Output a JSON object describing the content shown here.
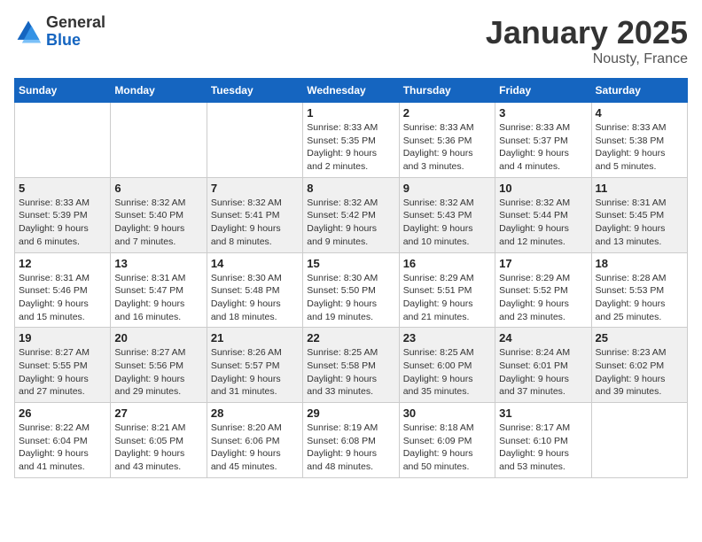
{
  "header": {
    "logo_general": "General",
    "logo_blue": "Blue",
    "month": "January 2025",
    "location": "Nousty, France"
  },
  "days_of_week": [
    "Sunday",
    "Monday",
    "Tuesday",
    "Wednesday",
    "Thursday",
    "Friday",
    "Saturday"
  ],
  "weeks": [
    [
      {
        "day": "",
        "info": ""
      },
      {
        "day": "",
        "info": ""
      },
      {
        "day": "",
        "info": ""
      },
      {
        "day": "1",
        "info": "Sunrise: 8:33 AM\nSunset: 5:35 PM\nDaylight: 9 hours\nand 2 minutes."
      },
      {
        "day": "2",
        "info": "Sunrise: 8:33 AM\nSunset: 5:36 PM\nDaylight: 9 hours\nand 3 minutes."
      },
      {
        "day": "3",
        "info": "Sunrise: 8:33 AM\nSunset: 5:37 PM\nDaylight: 9 hours\nand 4 minutes."
      },
      {
        "day": "4",
        "info": "Sunrise: 8:33 AM\nSunset: 5:38 PM\nDaylight: 9 hours\nand 5 minutes."
      }
    ],
    [
      {
        "day": "5",
        "info": "Sunrise: 8:33 AM\nSunset: 5:39 PM\nDaylight: 9 hours\nand 6 minutes."
      },
      {
        "day": "6",
        "info": "Sunrise: 8:32 AM\nSunset: 5:40 PM\nDaylight: 9 hours\nand 7 minutes."
      },
      {
        "day": "7",
        "info": "Sunrise: 8:32 AM\nSunset: 5:41 PM\nDaylight: 9 hours\nand 8 minutes."
      },
      {
        "day": "8",
        "info": "Sunrise: 8:32 AM\nSunset: 5:42 PM\nDaylight: 9 hours\nand 9 minutes."
      },
      {
        "day": "9",
        "info": "Sunrise: 8:32 AM\nSunset: 5:43 PM\nDaylight: 9 hours\nand 10 minutes."
      },
      {
        "day": "10",
        "info": "Sunrise: 8:32 AM\nSunset: 5:44 PM\nDaylight: 9 hours\nand 12 minutes."
      },
      {
        "day": "11",
        "info": "Sunrise: 8:31 AM\nSunset: 5:45 PM\nDaylight: 9 hours\nand 13 minutes."
      }
    ],
    [
      {
        "day": "12",
        "info": "Sunrise: 8:31 AM\nSunset: 5:46 PM\nDaylight: 9 hours\nand 15 minutes."
      },
      {
        "day": "13",
        "info": "Sunrise: 8:31 AM\nSunset: 5:47 PM\nDaylight: 9 hours\nand 16 minutes."
      },
      {
        "day": "14",
        "info": "Sunrise: 8:30 AM\nSunset: 5:48 PM\nDaylight: 9 hours\nand 18 minutes."
      },
      {
        "day": "15",
        "info": "Sunrise: 8:30 AM\nSunset: 5:50 PM\nDaylight: 9 hours\nand 19 minutes."
      },
      {
        "day": "16",
        "info": "Sunrise: 8:29 AM\nSunset: 5:51 PM\nDaylight: 9 hours\nand 21 minutes."
      },
      {
        "day": "17",
        "info": "Sunrise: 8:29 AM\nSunset: 5:52 PM\nDaylight: 9 hours\nand 23 minutes."
      },
      {
        "day": "18",
        "info": "Sunrise: 8:28 AM\nSunset: 5:53 PM\nDaylight: 9 hours\nand 25 minutes."
      }
    ],
    [
      {
        "day": "19",
        "info": "Sunrise: 8:27 AM\nSunset: 5:55 PM\nDaylight: 9 hours\nand 27 minutes."
      },
      {
        "day": "20",
        "info": "Sunrise: 8:27 AM\nSunset: 5:56 PM\nDaylight: 9 hours\nand 29 minutes."
      },
      {
        "day": "21",
        "info": "Sunrise: 8:26 AM\nSunset: 5:57 PM\nDaylight: 9 hours\nand 31 minutes."
      },
      {
        "day": "22",
        "info": "Sunrise: 8:25 AM\nSunset: 5:58 PM\nDaylight: 9 hours\nand 33 minutes."
      },
      {
        "day": "23",
        "info": "Sunrise: 8:25 AM\nSunset: 6:00 PM\nDaylight: 9 hours\nand 35 minutes."
      },
      {
        "day": "24",
        "info": "Sunrise: 8:24 AM\nSunset: 6:01 PM\nDaylight: 9 hours\nand 37 minutes."
      },
      {
        "day": "25",
        "info": "Sunrise: 8:23 AM\nSunset: 6:02 PM\nDaylight: 9 hours\nand 39 minutes."
      }
    ],
    [
      {
        "day": "26",
        "info": "Sunrise: 8:22 AM\nSunset: 6:04 PM\nDaylight: 9 hours\nand 41 minutes."
      },
      {
        "day": "27",
        "info": "Sunrise: 8:21 AM\nSunset: 6:05 PM\nDaylight: 9 hours\nand 43 minutes."
      },
      {
        "day": "28",
        "info": "Sunrise: 8:20 AM\nSunset: 6:06 PM\nDaylight: 9 hours\nand 45 minutes."
      },
      {
        "day": "29",
        "info": "Sunrise: 8:19 AM\nSunset: 6:08 PM\nDaylight: 9 hours\nand 48 minutes."
      },
      {
        "day": "30",
        "info": "Sunrise: 8:18 AM\nSunset: 6:09 PM\nDaylight: 9 hours\nand 50 minutes."
      },
      {
        "day": "31",
        "info": "Sunrise: 8:17 AM\nSunset: 6:10 PM\nDaylight: 9 hours\nand 53 minutes."
      },
      {
        "day": "",
        "info": ""
      }
    ]
  ]
}
